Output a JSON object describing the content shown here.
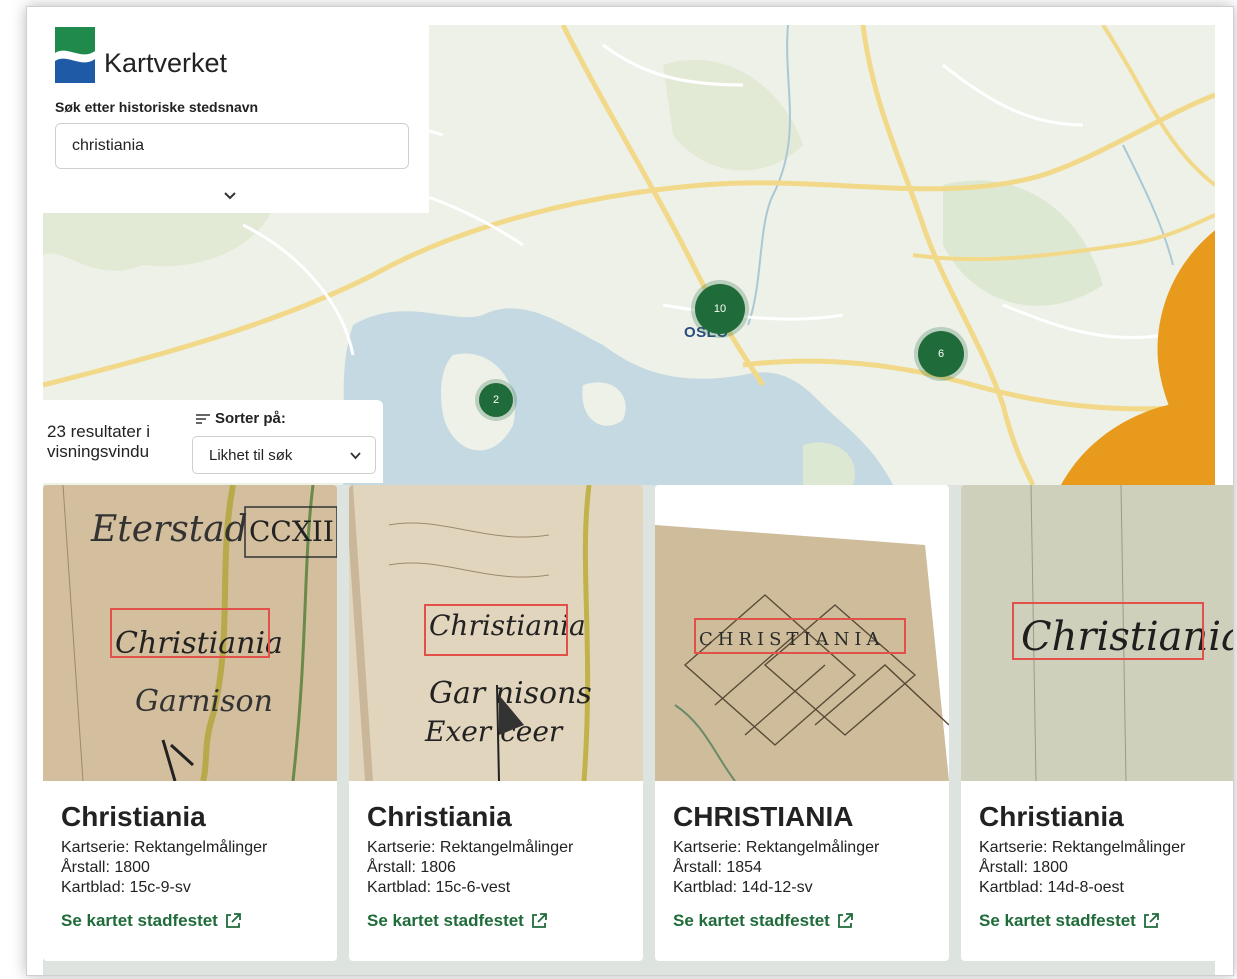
{
  "brand": {
    "name": "Kartverket",
    "icon": "kartverket-logo"
  },
  "search": {
    "label": "Søk etter historiske stedsnavn",
    "value": "christiania",
    "expand_icon": "chevron-down-icon"
  },
  "results": {
    "count_text": "23 resultater i visningsvindu",
    "sort_label": "Sorter på:",
    "sort_value": "Likhet til søk",
    "sort_icon": "sort-icon"
  },
  "map": {
    "city_label": "OSLO",
    "clusters": [
      "10",
      "6",
      "2"
    ],
    "colors": {
      "cluster": "#1f6b3a",
      "pin": "#e89a1c",
      "water": "#c4d9e2",
      "land": "#eef1e8",
      "road": "#f2d98a"
    }
  },
  "cards": [
    {
      "title": "Christiania",
      "series": "Kartserie: Rektangelmålinger",
      "year": "Årstall: 1800",
      "sheet": "Kartblad: 15c-9-sv",
      "link": "Se kartet stadfestet"
    },
    {
      "title": "Christiania",
      "series": "Kartserie: Rektangelmålinger",
      "year": "Årstall: 1806",
      "sheet": "Kartblad: 15c-6-vest",
      "link": "Se kartet stadfestet"
    },
    {
      "title": "CHRISTIANIA",
      "series": "Kartserie: Rektangelmålinger",
      "year": "Årstall: 1854",
      "sheet": "Kartblad: 14d-12-sv",
      "link": "Se kartet stadfestet"
    },
    {
      "title": "Christiania",
      "series": "Kartserie: Rektangelmålinger",
      "year": "Årstall: 1800",
      "sheet": "Kartblad: 14d-8-oest",
      "link": "Se kartet stadfestet"
    }
  ],
  "colors": {
    "accent": "#1f6b3a",
    "highlight_box": "#e2504a"
  }
}
